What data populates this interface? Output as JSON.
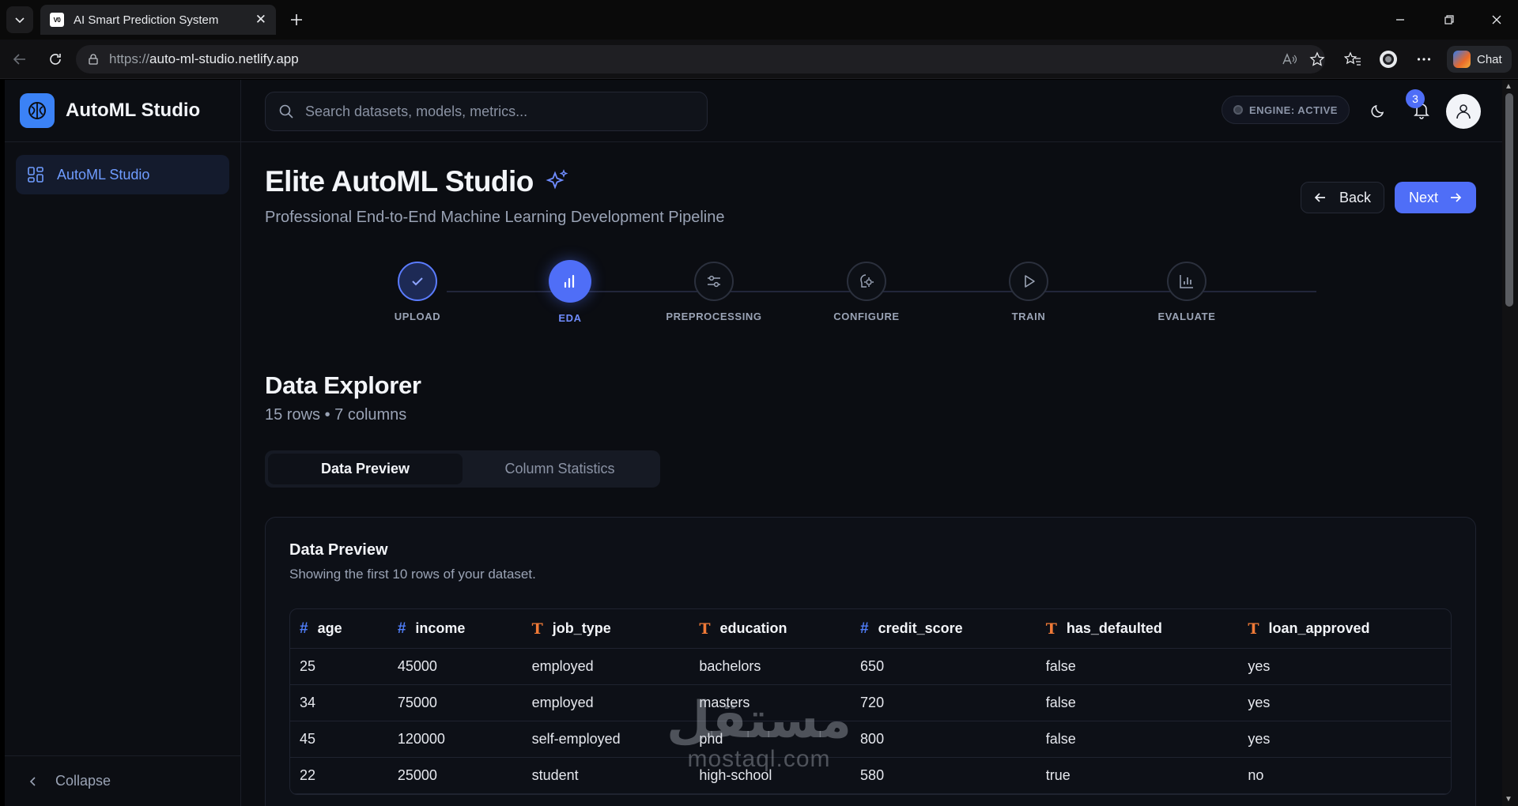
{
  "browser": {
    "tab_title": "AI Smart Prediction System",
    "favicon_text": "V0",
    "url_prefix": "https://",
    "url_host": "auto-ml-studio.netlify.app",
    "chat_label": "Chat"
  },
  "app": {
    "brand": "AutoML Studio",
    "sidebar": {
      "items": [
        {
          "label": "AutoML Studio",
          "icon": "dashboard-grid-icon"
        }
      ],
      "collapse_label": "Collapse"
    },
    "search": {
      "placeholder": "Search datasets, models, metrics..."
    },
    "engine_status": "ENGINE: ACTIVE",
    "notifications_count": "3"
  },
  "page": {
    "title": "Elite AutoML Studio",
    "subtitle": "Professional End-to-End Machine Learning Development Pipeline",
    "back_label": "Back",
    "next_label": "Next",
    "steps": [
      {
        "label": "UPLOAD",
        "state": "done",
        "icon": "check-icon"
      },
      {
        "label": "EDA",
        "state": "active",
        "icon": "bar-chart-icon"
      },
      {
        "label": "PREPROCESSING",
        "state": "pending",
        "icon": "sliders-icon"
      },
      {
        "label": "CONFIGURE",
        "state": "pending",
        "icon": "brain-gear-icon"
      },
      {
        "label": "TRAIN",
        "state": "pending",
        "icon": "play-icon"
      },
      {
        "label": "EVALUATE",
        "state": "pending",
        "icon": "chart-icon"
      }
    ]
  },
  "explorer": {
    "title": "Data Explorer",
    "summary": "15 rows • 7 columns",
    "tabs": [
      "Data Preview",
      "Column Statistics"
    ],
    "active_tab": "Data Preview",
    "card_title": "Data Preview",
    "card_subtitle": "Showing the first 10 rows of your dataset.",
    "columns": [
      {
        "name": "age",
        "type": "#"
      },
      {
        "name": "income",
        "type": "#"
      },
      {
        "name": "job_type",
        "type": "T"
      },
      {
        "name": "education",
        "type": "T"
      },
      {
        "name": "credit_score",
        "type": "#"
      },
      {
        "name": "has_defaulted",
        "type": "T"
      },
      {
        "name": "loan_approved",
        "type": "T"
      }
    ],
    "rows": [
      [
        "25",
        "45000",
        "employed",
        "bachelors",
        "650",
        "false",
        "yes"
      ],
      [
        "34",
        "75000",
        "employed",
        "masters",
        "720",
        "false",
        "yes"
      ],
      [
        "45",
        "120000",
        "self-employed",
        "phd",
        "800",
        "false",
        "yes"
      ],
      [
        "22",
        "25000",
        "student",
        "high-school",
        "580",
        "true",
        "no"
      ]
    ]
  },
  "watermark": {
    "arabic": "مستقل",
    "latin": "mostaql.com"
  },
  "colors": {
    "accent": "#4f6ef7",
    "background": "#0b0d12",
    "numeric_type": "#4f7df7",
    "text_type": "#f07a37"
  }
}
